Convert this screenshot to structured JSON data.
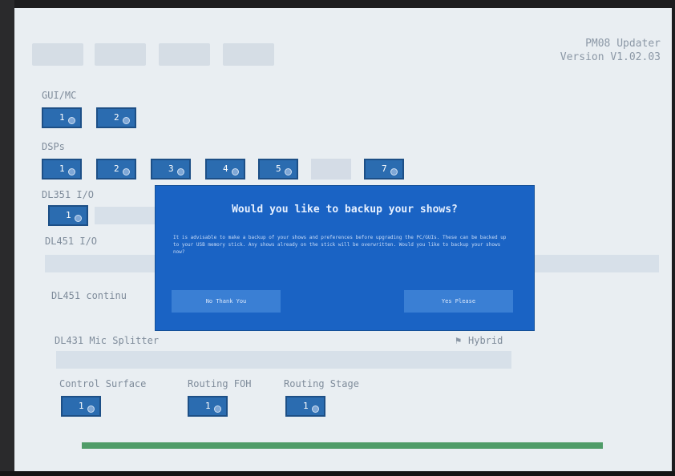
{
  "header": {
    "app_title": "PM08 Updater",
    "version": "Version V1.02.03"
  },
  "sections": {
    "gui_mc": {
      "label": "GUI/MC",
      "units": [
        "1",
        "2"
      ]
    },
    "dsps": {
      "label": "DSPs",
      "units": [
        "1",
        "2",
        "3",
        "4",
        "5",
        "",
        "7"
      ]
    },
    "dl351": {
      "label": "DL351 I/O",
      "units": [
        "1"
      ]
    },
    "dl451": {
      "label": "DL451 I/O"
    },
    "dl451_cont": {
      "label": "DL451 continu"
    },
    "dl431": {
      "label": "DL431 Mic Splitter",
      "side_label": "Hybrid"
    },
    "control_surface": {
      "label": "Control Surface",
      "units": [
        "1"
      ]
    },
    "routing_foh": {
      "label": "Routing FOH",
      "units": [
        "1"
      ]
    },
    "routing_stage": {
      "label": "Routing Stage",
      "units": [
        "1"
      ]
    }
  },
  "dialog": {
    "title": "Would you like to backup your shows?",
    "body": "It is advisable to make a backup of your shows and preferences before upgrading the PC/GUIs. These can be backed up to your USB memory stick. Any shows already on the stick will be overwritten. Would you like to backup your shows now?",
    "no_label": "No Thank You",
    "yes_label": "Yes Please"
  },
  "progress": {
    "value": 1.0,
    "color": "#4f9c68"
  },
  "icons": {
    "device_status": "gear-icon"
  },
  "colors": {
    "accent": "#1a63c4",
    "device_button": "#2b6cb0"
  }
}
